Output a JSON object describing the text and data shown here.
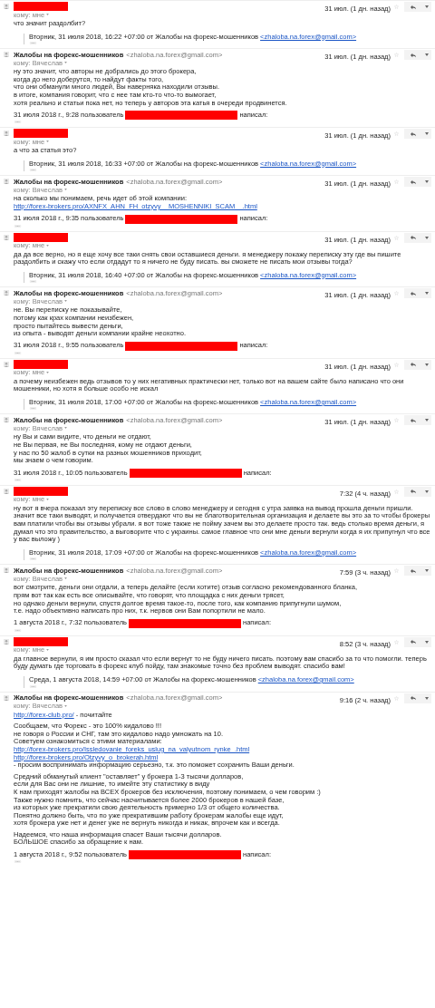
{
  "messages": [
    {
      "sender": {
        "kind": "redacted"
      },
      "to": "кому: мне",
      "date": "31 июл. (1 дн. назад)",
      "paragraphs": [
        [
          {
            "text": "что значит раздолбит?"
          }
        ]
      ],
      "footer": {
        "kind": "quote",
        "text": "Вторник, 31 июля 2018, 16:22 +07:00 от Жалобы на форекс-мошенников",
        "email": "<zhaloba.na.forex@gmail.com>"
      }
    },
    {
      "sender": {
        "kind": "named",
        "name": "Жалобы на форекс-мошенников",
        "email": "<zhaloba.na.forex@gmail.com>"
      },
      "to": "кому: Вячеслав",
      "date": "31 июл. (1 дн. назад)",
      "paragraphs": [
        [
          {
            "text": "ну это значит, что авторы не добрались до этого брокера,"
          },
          {
            "text": "когда до него доберутся, то найдут факты того,"
          },
          {
            "text": "что они обманули много людей, Вы наверняка находили отзывы."
          },
          {
            "text": "в итоге, компания говорит, что с нее там кто-то что-то вымогает,"
          },
          {
            "text": "хотя реально и статьи пока нет, но теперь у авторов эта катья в очереди продвинется."
          }
        ]
      ],
      "footer": {
        "kind": "attribution",
        "before": "31 июля 2018 г., 9:28 пользователь",
        "after": "написал:"
      }
    },
    {
      "sender": {
        "kind": "redacted"
      },
      "to": "кому: мне",
      "date": "31 июл. (1 дн. назад)",
      "paragraphs": [
        [
          {
            "text": "а что за статья это?"
          }
        ]
      ],
      "footer": {
        "kind": "quote",
        "text": "Вторник, 31 июля 2018, 16:33 +07:00 от Жалобы на форекс-мошенников",
        "email": "<zhaloba.na.forex@gmail.com>"
      }
    },
    {
      "sender": {
        "kind": "named",
        "name": "Жалобы на форекс-мошенников",
        "email": "<zhaloba.na.forex@gmail.com>"
      },
      "to": "кому: Вячеслав",
      "date": "31 июл. (1 дн. назад)",
      "paragraphs": [
        [
          {
            "text": "на сколько мы понимаем, речь идет об этой компании:"
          },
          {
            "link": "http://forex-brokers.pro/AXNFX_AHN_FH_otzyvy__MOSHENNIKI_SCAM__.html"
          }
        ]
      ],
      "footer": {
        "kind": "attribution",
        "before": "31 июля 2018 г., 9:35 пользователь",
        "after": "написал:"
      }
    },
    {
      "sender": {
        "kind": "redacted"
      },
      "to": "кому: мне",
      "date": "31 июл. (1 дн. назад)",
      "paragraphs": [
        [
          {
            "text": "да да все верно, но я еще хочу все таки снять свои оставшиеся деньги. я менеджеру покажу переписку эту где вы пишите раздолбить и скажу что если отдадут то я ничего не буду писать. вы сможете не писать мои отзывы тогда?"
          }
        ]
      ],
      "footer": {
        "kind": "quote",
        "text": "Вторник, 31 июля 2018, 16:40 +07:00 от Жалобы на форекс-мошенников",
        "email": "<zhaloba.na.forex@gmail.com>"
      }
    },
    {
      "sender": {
        "kind": "named",
        "name": "Жалобы на форекс-мошенников",
        "email": "<zhaloba.na.forex@gmail.com>"
      },
      "to": "кому: Вячеслав",
      "date": "31 июл. (1 дн. назад)",
      "paragraphs": [
        [
          {
            "text": "не. Вы переписку не показывайте,"
          },
          {
            "text": "потому как крах компании неизбежен,"
          },
          {
            "text": "просто пытайтесь вывести деньги,"
          },
          {
            "text": "из опыта - выводят деньги компании крайне неохотно."
          }
        ]
      ],
      "footer": {
        "kind": "attribution",
        "before": "31 июля 2018 г., 9:55 пользователь",
        "after": "написал:"
      }
    },
    {
      "sender": {
        "kind": "redacted"
      },
      "to": "кому: мне",
      "date": "31 июл. (1 дн. назад)",
      "paragraphs": [
        [
          {
            "text": "а почему неизбежен ведь отзывов то у них негативных практически нет, только вот на вашем сайте было написано что они мошенники, но хотя я больше особо не искал"
          }
        ]
      ],
      "footer": {
        "kind": "quote",
        "text": "Вторник, 31 июля 2018, 17:00 +07:00 от Жалобы на форекс-мошенников",
        "email": "<zhaloba.na.forex@gmail.com>"
      }
    },
    {
      "sender": {
        "kind": "named",
        "name": "Жалобы на форекс-мошенников",
        "email": "<zhaloba.na.forex@gmail.com>"
      },
      "to": "кому: Вячеслав",
      "date": "31 июл. (1 дн. назад)",
      "paragraphs": [
        [
          {
            "text": "ну Вы и сами видите, что деньги не отдают,"
          },
          {
            "text": "не Вы первая, не Вы последняя, кому не отдают деньги,"
          },
          {
            "text": "у нас по 50 жалоб в сутки на разных мошенников приходит,"
          },
          {
            "text": "мы знаем о чем говорим."
          }
        ]
      ],
      "footer": {
        "kind": "attribution",
        "before": "31 июля 2018 г., 10:05 пользователь",
        "after": "написал:"
      }
    },
    {
      "sender": {
        "kind": "redacted"
      },
      "to": "кому: мне",
      "date": "7:32 (4 ч. назад)",
      "paragraphs": [
        [
          {
            "text": "ну вот я вчера показал эту переписку все слово в слово менеджеру и сегодня с утра заявка на вывод прошла деньги пришли. значит все таки выводят, и получается отвердают что вы не благотворительная организация и делаете вы это за то чтобы брокеры вам платили чтобы вы отзывы убрали. я вот тоже также не пойму зачем вы это делаете просто так. ведь столько время деньги, я думал что это правительство, а выговорите что с украины. самое главное что они мне деньги вернули когда я их припугнул что все у вас выложу )"
          }
        ]
      ],
      "footer": {
        "kind": "quote",
        "text": "Вторник, 31 июля 2018, 17:09 +07:00 от Жалобы на форекс-мошенников",
        "email": "<zhaloba.na.forex@gmail.com>"
      }
    },
    {
      "sender": {
        "kind": "named",
        "name": "Жалобы на форекс-мошенников",
        "email": "<zhaloba.na.forex@gmail.com>"
      },
      "to": "кому: Вячеслав",
      "date": "7:59 (3 ч. назад)",
      "paragraphs": [
        [
          {
            "text": "вот смотрите, деньги они отдали, а теперь делайте (если хотите) отзыв согласно рекомендованного бланка,"
          },
          {
            "text": "прям вот так как есть все описывайте, что говорят, что площадка с них деньги трясет,"
          },
          {
            "text": "но однако деньги вернули, спустя долгое время такое-то, после того, как компанию припугнули шумом,"
          },
          {
            "text": "т.е. надо объективно написать про них, т.к. нервов они Вам попортили не мало."
          }
        ]
      ],
      "footer": {
        "kind": "attribution",
        "before": "1 августа 2018 г., 7:32 пользователь",
        "after": "написал:"
      }
    },
    {
      "sender": {
        "kind": "redacted"
      },
      "to": "кому: мне",
      "date": "8:52 (3 ч. назад)",
      "paragraphs": [
        [
          {
            "text": "да главное вернули, я им просто сказал что если вернут то не буду ничего писать. поэтому вам спасибо за то что помогли. теперь буду думать где торговать в форекс клуб пойду, там знакомые точно без проблем выводят. спасибо вам!"
          }
        ]
      ],
      "footer": {
        "kind": "quote",
        "text": "Среда, 1 августа 2018, 14:59 +07:00 от Жалобы на форекс-мошенников",
        "email": "<zhaloba.na.forex@gmail.com>"
      }
    },
    {
      "sender": {
        "kind": "named",
        "name": "Жалобы на форекс-мошенников",
        "email": "<zhaloba.na.forex@gmail.com>"
      },
      "to": "кому: Вячеслав",
      "date": "9:16 (2 ч. назад)",
      "paragraphs": [
        [
          {
            "link": "http://forex-club.pro/",
            "text": " - почитайте"
          }
        ],
        [
          {
            "text": "Сообщаем, что Форекс - это 100% кидалово !!!"
          },
          {
            "text": "не говоря о России и СНГ, там это кидалово надо умножать на 10."
          },
          {
            "text": "Советуем ознакомиться с этими материалами:"
          },
          {
            "link": "http://forex-brokers.pro/Issledovanie_foreks_uslug_na_valyutnom_rynke_.html"
          },
          {
            "link": "http://forex-brokers.pro/Otzyvy_o_brokerah.html"
          },
          {
            "text": " - просим воспринимать информацию серьезно, т.к. это поможет сохранить Ваши деньги."
          }
        ],
        [
          {
            "text": "Средний обманутый клиент \"оставляет\" у брокера 1-3 тысячи долларов,"
          },
          {
            "text": "если для Вас они не лишние, то имейте эту статистику в виду"
          },
          {
            "text": "К нам приходят жалобы на ВСЕХ брокеров без исключения, поэтому понимаем, о чем говорим :)"
          },
          {
            "text": "Также нужно помнить, что сейчас насчитывается более 2000 брокеров в нашей базе,"
          },
          {
            "text": "из которых уже прекратили свою деятельность примерно 1/3 от общего количества."
          },
          {
            "text": "Понятно должно быть, что по уже прекратившим работу брокерам жалобы еще идут,"
          },
          {
            "text": "хотя брокера уже нет и денег уже не вернуть никогда и никак, впрочем как и всегда."
          }
        ],
        [
          {
            "text": "Надеемся, что наша информация спасет Ваши тысячи долларов."
          },
          {
            "text": "БОЛЬШОЕ спасибо за обращение к нам."
          }
        ]
      ],
      "footer": {
        "kind": "attribution",
        "before": "1 августа 2018 г., 9:52 пользователь",
        "after": "написал:"
      }
    }
  ]
}
